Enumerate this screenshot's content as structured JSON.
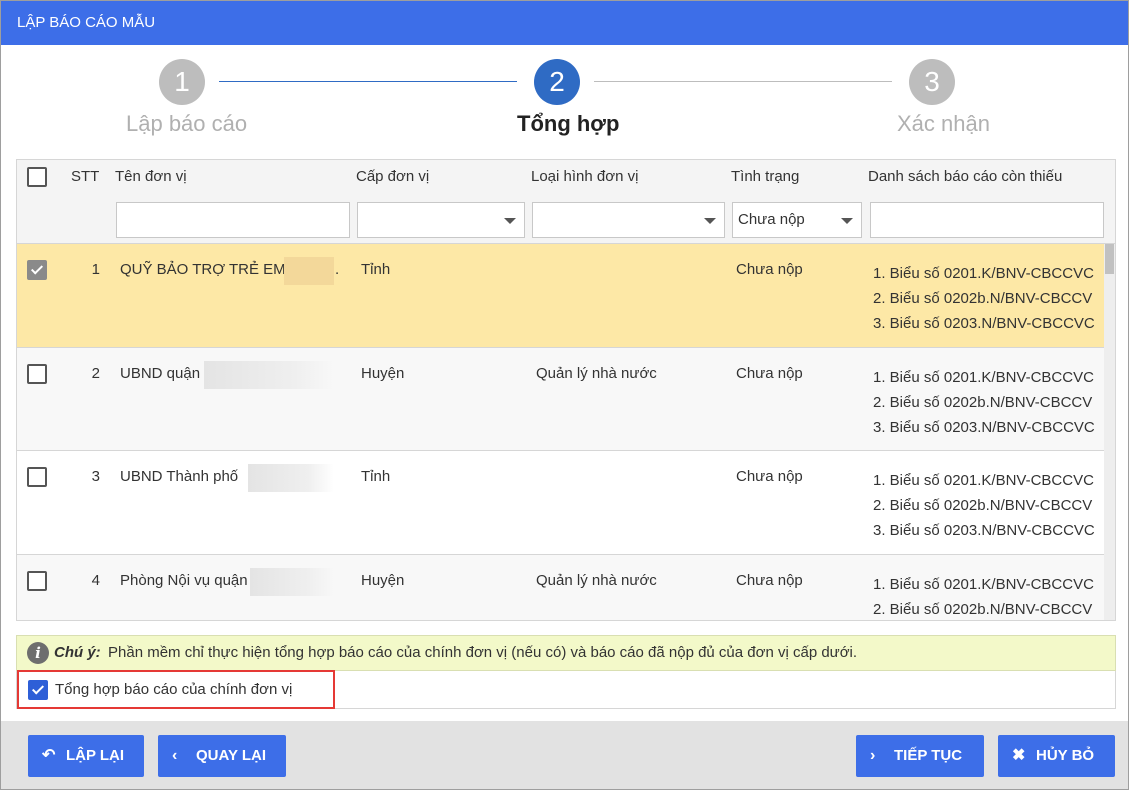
{
  "title": "LẬP BÁO CÁO MẪU",
  "steps": [
    {
      "number": "1",
      "label": "Lập báo cáo"
    },
    {
      "number": "2",
      "label": "Tổng hợp"
    },
    {
      "number": "3",
      "label": "Xác nhận"
    }
  ],
  "columns": {
    "stt": "STT",
    "name": "Tên đơn vị",
    "level": "Cấp đơn vị",
    "type": "Loại hình đơn vị",
    "status": "Tình trạng",
    "missing": "Danh sách báo cáo còn thiếu"
  },
  "filters": {
    "name": "",
    "level": "",
    "type": "",
    "status": "Chưa nộp",
    "missing": ""
  },
  "rows": [
    {
      "stt": "1",
      "name": "QUỸ BẢO TRỢ TRẺ EM",
      "name_suffix": ".",
      "level": "Tỉnh",
      "type": "",
      "status": "Chưa nộp",
      "checked": true,
      "reports": [
        "1. Biểu số 0201.K/BNV-CBCCVC",
        "2. Biểu số 0202b.N/BNV-CBCCV",
        "3. Biểu số 0203.N/BNV-CBCCVC"
      ]
    },
    {
      "stt": "2",
      "name": "UBND quận",
      "level": "Huyện",
      "type": "Quản lý nhà nước",
      "status": "Chưa nộp",
      "checked": false,
      "reports": [
        "1. Biểu số 0201.K/BNV-CBCCVC",
        "2. Biểu số 0202b.N/BNV-CBCCV",
        "3. Biểu số 0203.N/BNV-CBCCVC"
      ]
    },
    {
      "stt": "3",
      "name": "UBND Thành phố",
      "level": "Tỉnh",
      "type": "",
      "status": "Chưa nộp",
      "checked": false,
      "reports": [
        "1. Biểu số 0201.K/BNV-CBCCVC",
        "2. Biểu số 0202b.N/BNV-CBCCV",
        "3. Biểu số 0203.N/BNV-CBCCVC"
      ]
    },
    {
      "stt": "4",
      "name": "Phòng Nội vụ quận",
      "level": "Huyện",
      "type": "Quản lý nhà nước",
      "status": "Chưa nộp",
      "checked": false,
      "reports": [
        "1. Biểu số 0201.K/BNV-CBCCVC",
        "2. Biểu số 0202b.N/BNV-CBCCV"
      ]
    }
  ],
  "note": {
    "label": "Chú ý:",
    "text": "Phần mềm chỉ thực hiện tổng hợp báo cáo của chính đơn vị (nếu có) và báo cáo đã nộp đủ của đơn vị cấp dưới."
  },
  "option": {
    "label": "Tổng hợp báo cáo của chính đơn vị",
    "checked": true
  },
  "buttons": {
    "reset": "LẬP LẠI",
    "back": "QUAY LẠI",
    "next": "TIẾP TỤC",
    "cancel": "HỦY BỎ"
  },
  "colors": {
    "titlebar": "#3d6ee8",
    "step_active": "#2f6bc4",
    "selected_row": "#fde8a6",
    "note_bg": "#f3f9c9",
    "highlight_border": "#e53935"
  }
}
